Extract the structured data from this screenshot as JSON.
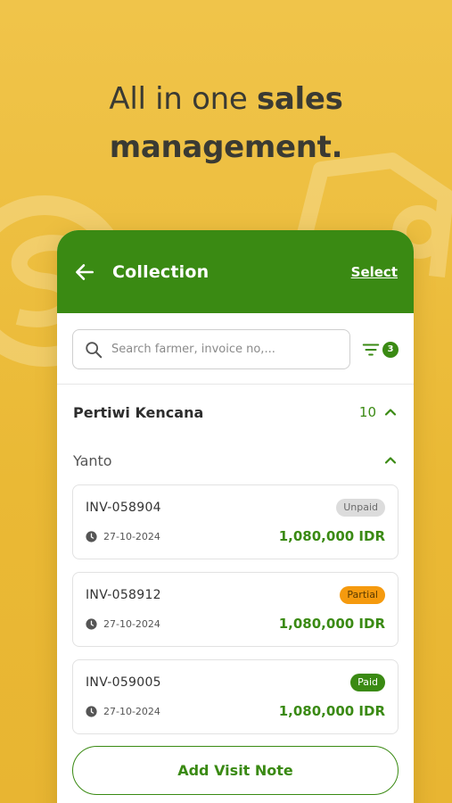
{
  "headline": {
    "light": "All in one ",
    "bold1": "sales",
    "bold2": "management."
  },
  "app": {
    "title": "Collection",
    "select_label": "Select",
    "search": {
      "placeholder": "Search farmer, invoice no,..."
    },
    "filter_count": "3",
    "group": {
      "name": "Pertiwi Kencana",
      "count": "10"
    },
    "subgroup": {
      "name": "Yanto"
    },
    "invoices": [
      {
        "number": "INV-058904",
        "status": "Unpaid",
        "date": "27-10-2024",
        "amount": "1,080,000 IDR"
      },
      {
        "number": "INV-058912",
        "status": "Partial",
        "date": "27-10-2024",
        "amount": "1,080,000 IDR"
      },
      {
        "number": "INV-059005",
        "status": "Paid",
        "date": "27-10-2024",
        "amount": "1,080,000 IDR"
      }
    ],
    "visit_button": "Add Visit Note"
  },
  "colors": {
    "background": "#EDBE3A",
    "brand_green": "#3A8A13",
    "status_unpaid": "#dcdcdc",
    "status_partial": "#F59A0E",
    "status_paid": "#3A8A13"
  },
  "icons": [
    "back-arrow-icon",
    "search-icon",
    "filter-icon",
    "chevron-up-icon",
    "clock-icon"
  ]
}
